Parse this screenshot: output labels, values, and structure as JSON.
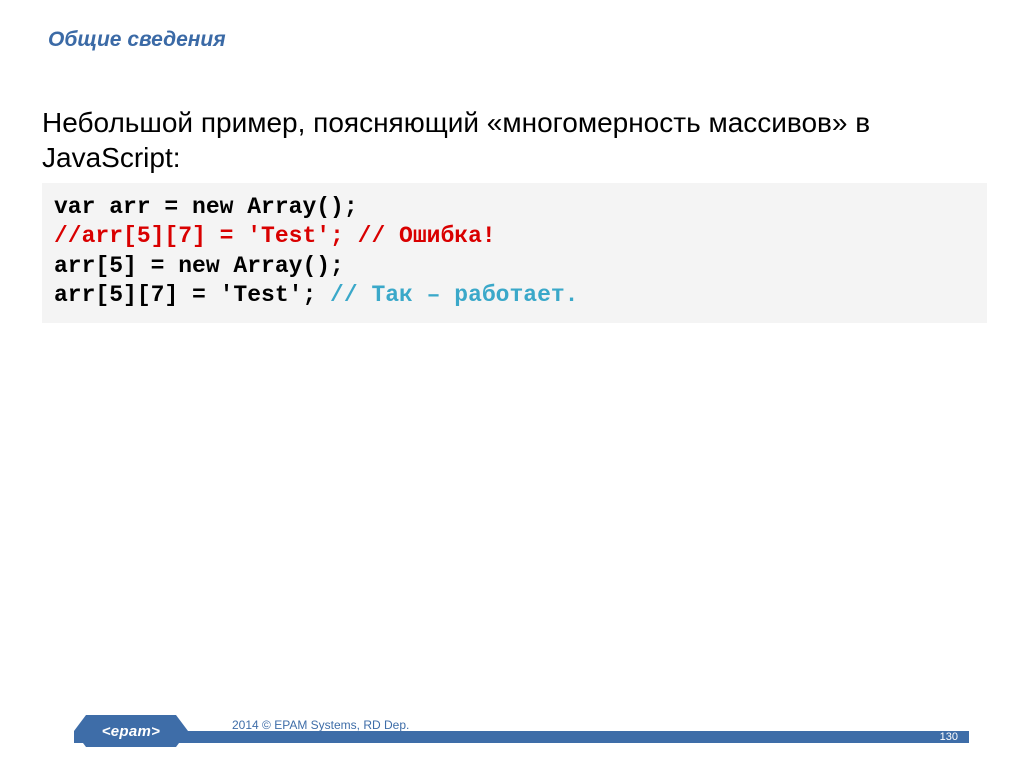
{
  "heading": "Общие сведения",
  "lead": "Небольшой пример, поясняющий «многомерность массивов» в JavaScript:",
  "code": {
    "line1": "var arr = new Array();",
    "line2": "//arr[5][7] = 'Test'; // Ошибка!",
    "line3": "arr[5] = new Array();",
    "line4a": "arr[5][7] = 'Test'; ",
    "line4b": "// Так – работает."
  },
  "footer": {
    "logo_text": "<epam>",
    "copyright": "2014 © EPAM Systems, RD Dep.",
    "page_number": "130"
  },
  "colors": {
    "brand_blue": "#3e6da8",
    "heading_blue": "#3b6aa6",
    "code_bg": "#f4f4f4",
    "code_red": "#d90000",
    "code_cyan": "#3aa8c9"
  }
}
